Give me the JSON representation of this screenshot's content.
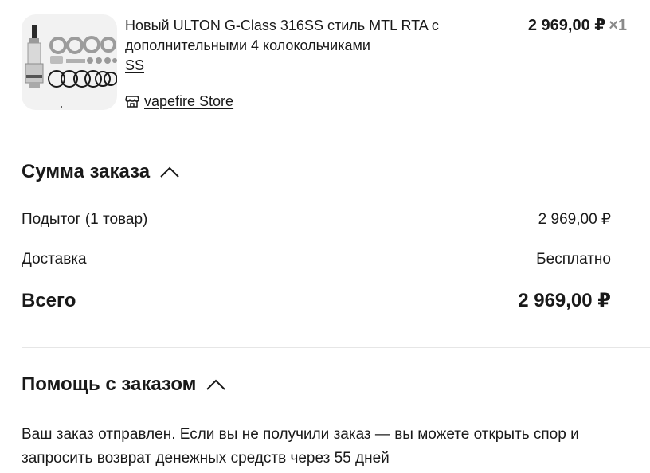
{
  "product": {
    "title": "Новый ULTON G-Class 316SS стиль MTL RTA с дополнительными 4 колокольчиками",
    "variant": "SS",
    "store_name": "vapefire Store",
    "store_icon": "store-icon",
    "price": "2 969,00 ₽",
    "quantity": "×1"
  },
  "order_summary": {
    "title": "Сумма заказа",
    "toggle_icon": "chevron-up-icon",
    "subtotal_label": "Подытог (1 товар)",
    "subtotal_value": "2 969,00 ₽",
    "delivery_label": "Доставка",
    "delivery_value": "Бесплатно",
    "total_label": "Всего",
    "total_value": "2 969,00 ₽"
  },
  "help": {
    "title": "Помощь с заказом",
    "toggle_icon": "chevron-up-icon",
    "text": "Ваш заказ отправлен. Если вы не получили заказ — вы можете открыть спор и запросить возврат денежных средств через 55 дней"
  }
}
